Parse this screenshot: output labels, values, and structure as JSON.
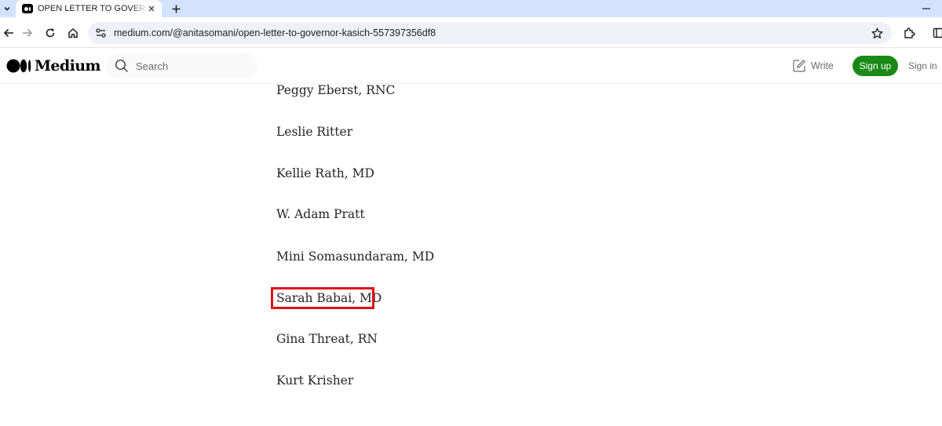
{
  "browser": {
    "tab_title": "OPEN LETTER TO GOVERNOR KASICH",
    "url": "medium.com/@anitasomani/open-letter-to-governor-kasich-557397356df8",
    "icons": [
      "chevron-down-icon",
      "close-icon",
      "plus-icon",
      "minimize-icon",
      "back-icon",
      "forward-icon",
      "reload-icon",
      "home-icon",
      "site-info-icon",
      "star-icon",
      "extensions-icon",
      "side-panel-icon"
    ]
  },
  "header": {
    "logo_text": "Medium",
    "search_placeholder": "Search",
    "write_label": "Write",
    "signup_label": "Sign up",
    "signin_label": "Sign in",
    "colors": {
      "signup_bg": "#1a8917",
      "text_muted": "#6b6b6b"
    }
  },
  "article": {
    "names": [
      "Peggy Eberst, RNC",
      "Leslie Ritter",
      "Kellie Rath, MD",
      "W. Adam Pratt",
      "Mini Somasundaram, MD",
      "Sarah Babai, MD",
      "Gina Threat, RN",
      "Kurt Krisher"
    ],
    "highlighted_name": "Sarah Babai, MD",
    "highlight_color": "#e0101a"
  }
}
